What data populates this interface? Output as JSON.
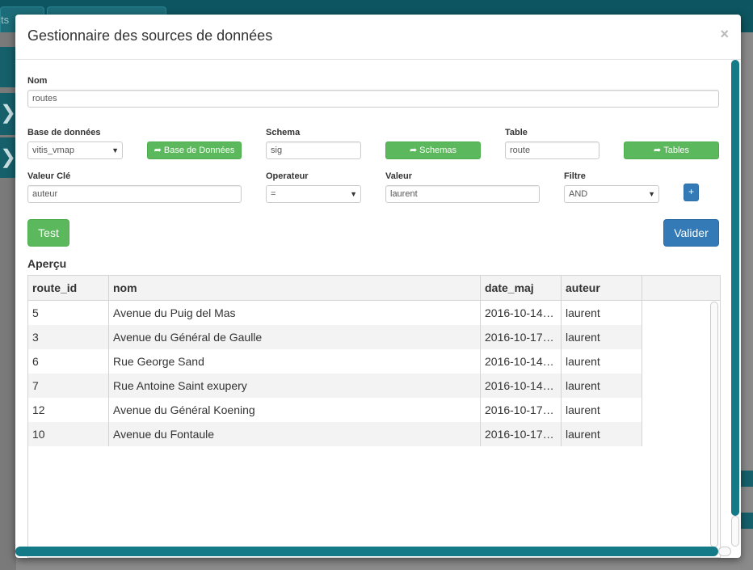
{
  "background": {
    "tab1_label": "ts"
  },
  "modal": {
    "title": "Gestionnaire des sources de données",
    "close_label": "×"
  },
  "form": {
    "nom": {
      "label": "Nom",
      "value": "routes"
    },
    "base": {
      "label": "Base de données",
      "value": "vitis_vmap",
      "button": "Base de Données"
    },
    "schema": {
      "label": "Schema",
      "value": "sig",
      "button": "Schemas"
    },
    "table": {
      "label": "Table",
      "value": "route",
      "button": "Tables"
    },
    "valeur_cle": {
      "label": "Valeur Clé",
      "value": "auteur"
    },
    "operateur": {
      "label": "Operateur",
      "value": "="
    },
    "valeur": {
      "label": "Valeur",
      "value": "laurent"
    },
    "filtre": {
      "label": "Filtre",
      "value": "AND"
    },
    "add_label": "+",
    "test_label": "Test",
    "valider_label": "Valider"
  },
  "preview": {
    "title": "Aperçu",
    "columns": [
      "route_id",
      "nom",
      "date_maj",
      "auteur"
    ],
    "rows": [
      [
        "5",
        "Avenue du Puig del Mas",
        "2016-10-14…",
        "laurent"
      ],
      [
        "3",
        "Avenue du Général de Gaulle",
        "2016-10-17…",
        "laurent"
      ],
      [
        "6",
        "Rue George Sand",
        "2016-10-14…",
        "laurent"
      ],
      [
        "7",
        "Rue Antoine Saint exupery",
        "2016-10-14…",
        "laurent"
      ],
      [
        "12",
        "Avenue du Général Koening",
        "2016-10-17…",
        "laurent"
      ],
      [
        "10",
        "Avenue du Fontaule",
        "2016-10-17…",
        "laurent"
      ]
    ]
  },
  "colors": {
    "primary": "#337ab7",
    "success": "#5cb85c",
    "scrollbar": "#157a87",
    "app_bar": "#0d5560"
  }
}
